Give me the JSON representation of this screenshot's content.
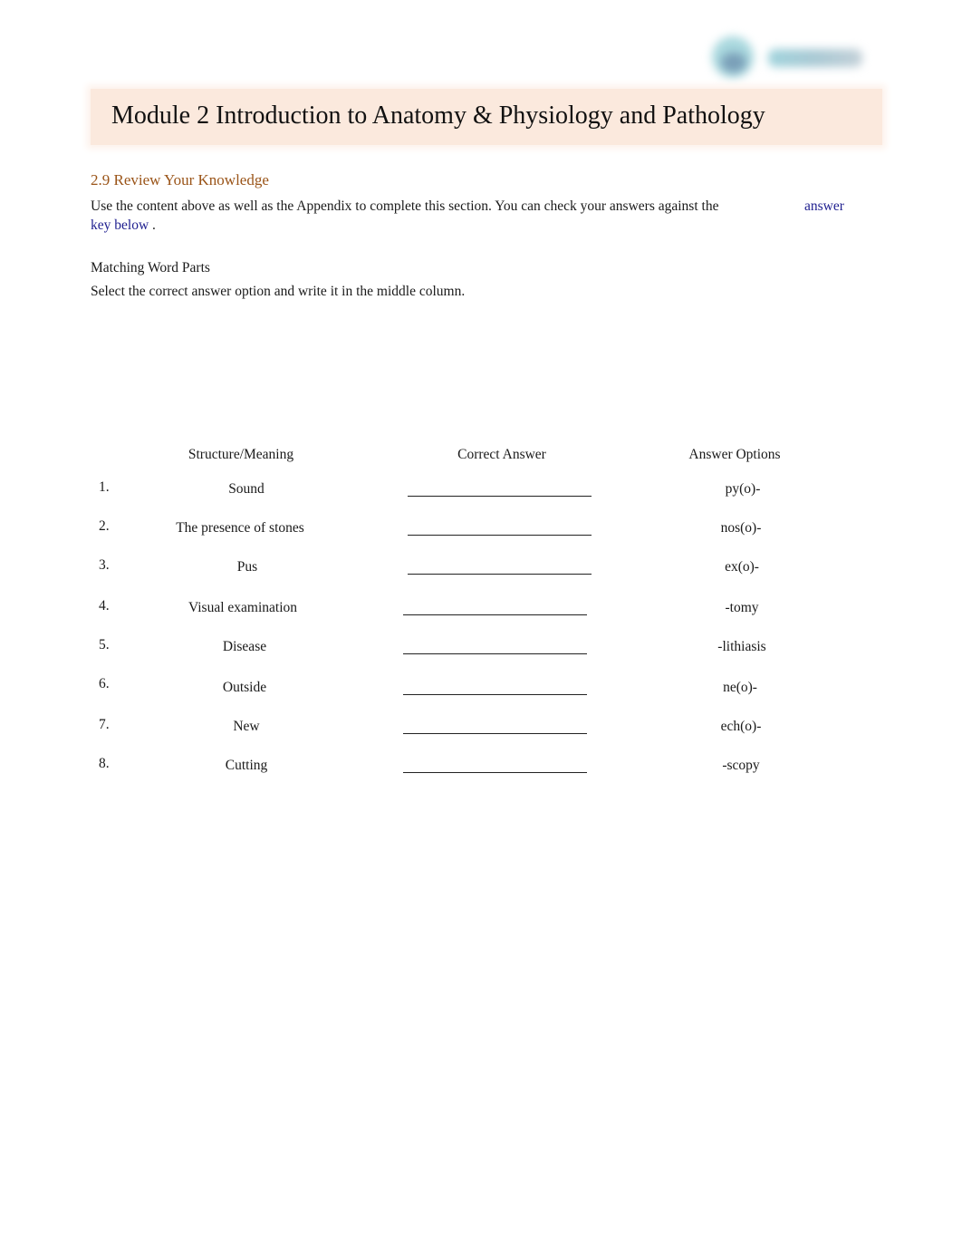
{
  "logo": {
    "name": "logo"
  },
  "header": {
    "title": "Module 2 Introduction to Anatomy & Physiology and Pathology"
  },
  "section": {
    "title": "2.9 Review Your Knowledge",
    "intro_text": "Use the content above as well as the Appendix to complete this section. You can check your answers against the",
    "link_part1": "answer",
    "link_part2": "key below",
    "intro_end": "."
  },
  "exercise": {
    "heading": "Matching Word Parts",
    "instruction": "Select the correct answer option and write it in the middle column.",
    "columns": [
      "Structure/Meaning",
      "Correct Answer",
      "Answer Options"
    ],
    "rows": [
      {
        "number": "1.",
        "meaning": "Sound",
        "answer": "",
        "option": "py(o)-"
      },
      {
        "number": "2.",
        "meaning": "The presence of stones",
        "answer": "",
        "option": "nos(o)-"
      },
      {
        "number": "3.",
        "meaning": "Pus",
        "answer": "",
        "option": "ex(o)-"
      },
      {
        "number": "4.",
        "meaning": "Visual examination",
        "answer": "",
        "option": "-tomy"
      },
      {
        "number": "5.",
        "meaning": "Disease",
        "answer": "",
        "option": "-lithiasis"
      },
      {
        "number": "6.",
        "meaning": "Outside",
        "answer": "",
        "option": "ne(o)-"
      },
      {
        "number": "7.",
        "meaning": "New",
        "answer": "",
        "option": "ech(o)-"
      },
      {
        "number": "8.",
        "meaning": "Cutting",
        "answer": "",
        "option": "-scopy"
      }
    ]
  }
}
